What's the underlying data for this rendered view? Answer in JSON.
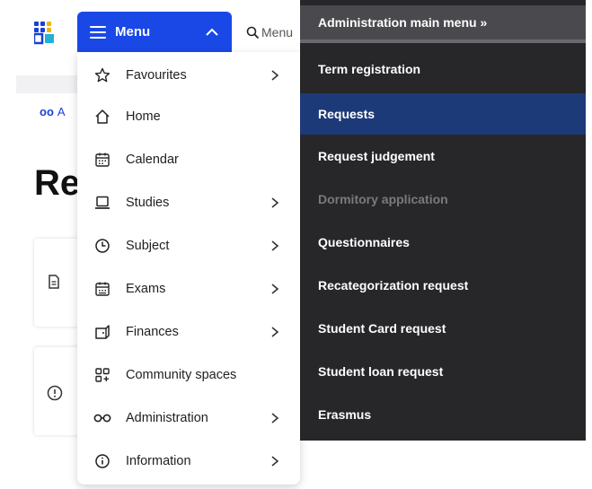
{
  "search": {
    "placeholder": "Menu"
  },
  "menu_button": {
    "label": "Menu"
  },
  "breadcrumb": {
    "text": "A"
  },
  "page": {
    "title": "Re"
  },
  "main_menu": {
    "items": [
      {
        "label": "Favourites",
        "icon": "star-icon",
        "has_submenu": true
      },
      {
        "label": "Home",
        "icon": "home-icon",
        "has_submenu": false
      },
      {
        "label": "Calendar",
        "icon": "calendar-icon",
        "has_submenu": false
      },
      {
        "label": "Studies",
        "icon": "laptop-icon",
        "has_submenu": true
      },
      {
        "label": "Subject",
        "icon": "clock-icon",
        "has_submenu": true
      },
      {
        "label": "Exams",
        "icon": "exam-calendar-icon",
        "has_submenu": true
      },
      {
        "label": "Finances",
        "icon": "wallet-icon",
        "has_submenu": true
      },
      {
        "label": "Community spaces",
        "icon": "grid-add-icon",
        "has_submenu": false
      },
      {
        "label": "Administration",
        "icon": "glasses-icon",
        "has_submenu": true
      },
      {
        "label": "Information",
        "icon": "info-icon",
        "has_submenu": true
      }
    ]
  },
  "admin_submenu": {
    "header": "Administration main menu »",
    "items": [
      {
        "label": "Term registration",
        "state": "normal"
      },
      {
        "label": "Requests",
        "state": "active"
      },
      {
        "label": "Request judgement",
        "state": "normal"
      },
      {
        "label": "Dormitory application",
        "state": "disabled"
      },
      {
        "label": "Questionnaires",
        "state": "normal"
      },
      {
        "label": "Recategorization request",
        "state": "normal"
      },
      {
        "label": "Student Card request",
        "state": "normal"
      },
      {
        "label": "Student loan request",
        "state": "normal"
      },
      {
        "label": "Erasmus",
        "state": "normal"
      }
    ]
  },
  "colors": {
    "accent": "#1a48e6",
    "submenu_bg": "#27272a",
    "submenu_active": "#1d3a78",
    "link": "#1a3fd6"
  }
}
